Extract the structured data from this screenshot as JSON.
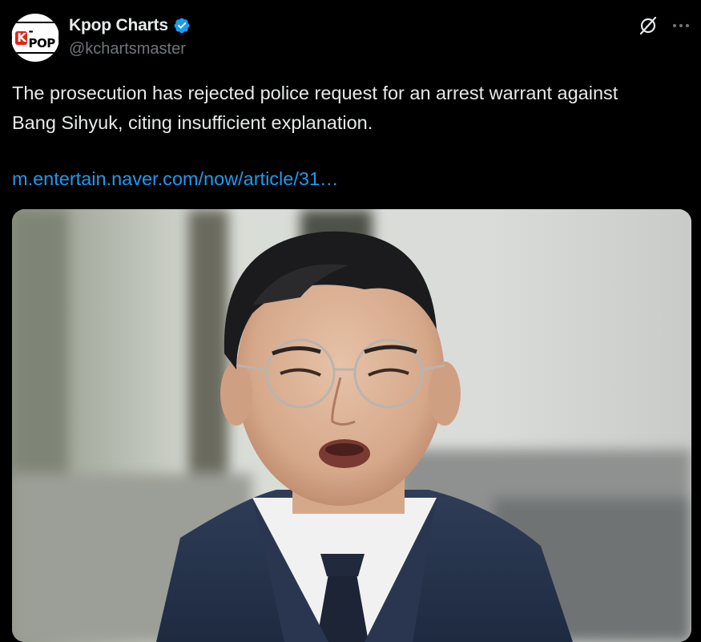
{
  "author": {
    "display_name": "Kpop Charts",
    "handle": "@kchartsmaster",
    "verified": true,
    "avatar_logo": "K-POP"
  },
  "tweet": {
    "text_line1": "The prosecution has rejected police request for an arrest warrant against",
    "text_line2": "Bang Sihyuk, citing insufficient explanation.",
    "link_text": "m.entertain.naver.com/now/article/31…"
  },
  "icons": {
    "verified": "verified-badge-icon",
    "grok": "grok-icon",
    "more": "more-options-icon"
  },
  "colors": {
    "background": "#000000",
    "text_primary": "#e7e9ea",
    "text_secondary": "#71767b",
    "link": "#1d9bf0",
    "verified": "#1d9bf0"
  }
}
